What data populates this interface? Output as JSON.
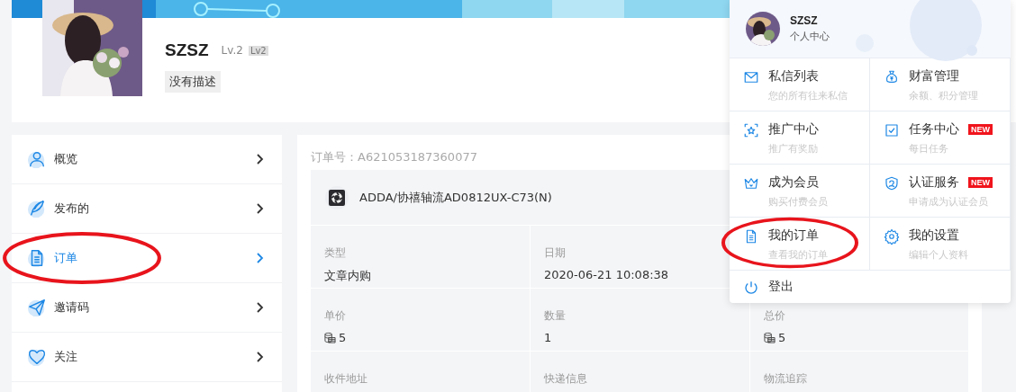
{
  "profile": {
    "name": "SZSZ",
    "level_text": "Lv.2",
    "level_badge": "Lv2",
    "description": "没有描述"
  },
  "sidebar": {
    "items": [
      {
        "label": "概览",
        "selected": false,
        "circled": false
      },
      {
        "label": "发布的",
        "selected": false,
        "circled": false
      },
      {
        "label": "订单",
        "selected": true,
        "circled": true
      },
      {
        "label": "邀请码",
        "selected": false,
        "circled": false
      },
      {
        "label": "关注",
        "selected": false,
        "circled": false
      }
    ]
  },
  "order": {
    "number_label": "订单号：A621053187360077",
    "product": "ADDA/协禧轴流AD0812UX-C73(N)",
    "fields": [
      {
        "label": "类型",
        "value": "文章内购",
        "kind": "plain"
      },
      {
        "label": "日期",
        "value": "2020-06-21 10:08:38",
        "kind": "plain"
      },
      {
        "label": "单价",
        "value": "5",
        "kind": "coin"
      },
      {
        "label": "数量",
        "value": "1",
        "kind": "plain"
      },
      {
        "label": "总价",
        "value": "5",
        "kind": "coin"
      },
      {
        "label": "收件地址"
      },
      {
        "label": "快递信息"
      },
      {
        "label": "物流追踪"
      }
    ]
  },
  "user_menu": {
    "name": "SZSZ",
    "subtitle": "个人中心",
    "items": [
      {
        "title": "私信列表",
        "subtitle": "您的所有往来私信",
        "circled": false
      },
      {
        "title": "财富管理",
        "subtitle": "余额、积分管理",
        "circled": false
      },
      {
        "title": "推广中心",
        "subtitle": "推广有奖励",
        "circled": false
      },
      {
        "title": "任务中心",
        "subtitle": "每日任务",
        "badge": "NEW",
        "circled": false
      },
      {
        "title": "成为会员",
        "subtitle": "购买付费会员",
        "circled": false
      },
      {
        "title": "认证服务",
        "subtitle": "申请成为认证会员",
        "badge": "NEW",
        "circled": false
      },
      {
        "title": "我的订单",
        "subtitle": "查看我的订单",
        "circled": true
      },
      {
        "title": "我的设置",
        "subtitle": "编辑个人资料",
        "circled": false
      }
    ],
    "logout": "登出"
  }
}
